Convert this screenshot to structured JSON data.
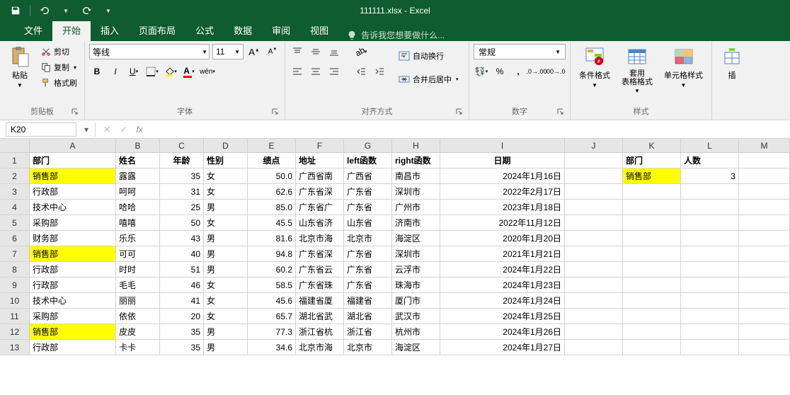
{
  "app": {
    "title": "111111.xlsx - Excel"
  },
  "qat": {
    "save": "save-icon",
    "undo": "undo-icon",
    "redo": "redo-icon"
  },
  "tabs": {
    "file": "文件",
    "home": "开始",
    "insert": "插入",
    "pagelayout": "页面布局",
    "formulas": "公式",
    "data": "数据",
    "review": "审阅",
    "view": "视图",
    "tellme": "告诉我您想要做什么..."
  },
  "ribbon": {
    "clipboard": {
      "paste": "粘贴",
      "cut": "剪切",
      "copy": "复制",
      "painter": "格式刷",
      "label": "剪贴板"
    },
    "font": {
      "name": "等线",
      "size": "11",
      "bold": "B",
      "italic": "I",
      "underline": "U",
      "wen": "wén",
      "label": "字体"
    },
    "alignment": {
      "wrap": "自动换行",
      "merge": "合并后居中",
      "label": "对齐方式"
    },
    "number": {
      "format": "常规",
      "label": "数字"
    },
    "styles": {
      "cond": "条件格式",
      "table": "套用\n表格格式",
      "cell": "单元格样式",
      "label": "样式"
    },
    "insert_group": {
      "insert": "插"
    }
  },
  "formula_bar": {
    "name_box": "K20",
    "formula": ""
  },
  "columns": [
    "A",
    "B",
    "C",
    "D",
    "E",
    "F",
    "G",
    "H",
    "I",
    "J",
    "K",
    "L",
    "M"
  ],
  "lookup": {
    "header_dept": "部门",
    "header_count": "人数",
    "dept": "销售部",
    "count": "3"
  },
  "headers": [
    "部门",
    "姓名",
    "年龄",
    "性别",
    "绩点",
    "地址",
    "left函数",
    "right函数",
    "日期"
  ],
  "chart_data": {
    "type": "table",
    "columns": [
      "部门",
      "姓名",
      "年龄",
      "性别",
      "绩点",
      "地址",
      "left函数",
      "right函数",
      "日期"
    ],
    "rows": [
      {
        "部门": "销售部",
        "姓名": "露露",
        "年龄": 35,
        "性别": "女",
        "绩点": 50.0,
        "地址": "广西省南",
        "left函数": "广西省",
        "right函数": "南昌市",
        "日期": "2024年1月16日",
        "highlight": true
      },
      {
        "部门": "行政部",
        "姓名": "呵呵",
        "年龄": 31,
        "性别": "女",
        "绩点": 62.6,
        "地址": "广东省深",
        "left函数": "广东省",
        "right函数": "深圳市",
        "日期": "2022年2月17日"
      },
      {
        "部门": "技术中心",
        "姓名": "哈哈",
        "年龄": 25,
        "性别": "男",
        "绩点": 85.0,
        "地址": "广东省广",
        "left函数": "广东省",
        "right函数": "广州市",
        "日期": "2023年1月18日"
      },
      {
        "部门": "采购部",
        "姓名": "嘻嘻",
        "年龄": 50,
        "性别": "女",
        "绩点": 45.5,
        "地址": "山东省济",
        "left函数": "山东省",
        "right函数": "济南市",
        "日期": "2022年11月12日"
      },
      {
        "部门": "财务部",
        "姓名": "乐乐",
        "年龄": 43,
        "性别": "男",
        "绩点": 81.6,
        "地址": "北京市海",
        "left函数": "北京市",
        "right函数": "海淀区",
        "日期": "2020年1月20日"
      },
      {
        "部门": "销售部",
        "姓名": "可可",
        "年龄": 40,
        "性别": "男",
        "绩点": 94.8,
        "地址": "广东省深",
        "left函数": "广东省",
        "right函数": "深圳市",
        "日期": "2021年1月21日",
        "highlight": true
      },
      {
        "部门": "行政部",
        "姓名": "时时",
        "年龄": 51,
        "性别": "男",
        "绩点": 60.2,
        "地址": "广东省云",
        "left函数": "广东省",
        "right函数": "云浮市",
        "日期": "2024年1月22日"
      },
      {
        "部门": "行政部",
        "姓名": "毛毛",
        "年龄": 46,
        "性别": "女",
        "绩点": 58.5,
        "地址": "广东省珠",
        "left函数": "广东省",
        "right函数": "珠海市",
        "日期": "2024年1月23日"
      },
      {
        "部门": "技术中心",
        "姓名": "丽丽",
        "年龄": 41,
        "性别": "女",
        "绩点": 45.6,
        "地址": "福建省厦",
        "left函数": "福建省",
        "right函数": "厦门市",
        "日期": "2024年1月24日"
      },
      {
        "部门": "采购部",
        "姓名": "依依",
        "年龄": 20,
        "性别": "女",
        "绩点": 65.7,
        "地址": "湖北省武",
        "left函数": "湖北省",
        "right函数": "武汉市",
        "日期": "2024年1月25日"
      },
      {
        "部门": "销售部",
        "姓名": "皮皮",
        "年龄": 35,
        "性别": "男",
        "绩点": 77.3,
        "地址": "浙江省杭",
        "left函数": "浙江省",
        "right函数": "杭州市",
        "日期": "2024年1月26日",
        "highlight": true
      },
      {
        "部门": "行政部",
        "姓名": "卡卡",
        "年龄": 35,
        "性别": "男",
        "绩点": 34.6,
        "地址": "北京市海",
        "left函数": "北京市",
        "right函数": "海淀区",
        "日期": "2024年1月27日"
      }
    ]
  },
  "colors": {
    "brand": "#0e5c2f",
    "highlight": "#ffff00",
    "selection": "#107c41"
  }
}
